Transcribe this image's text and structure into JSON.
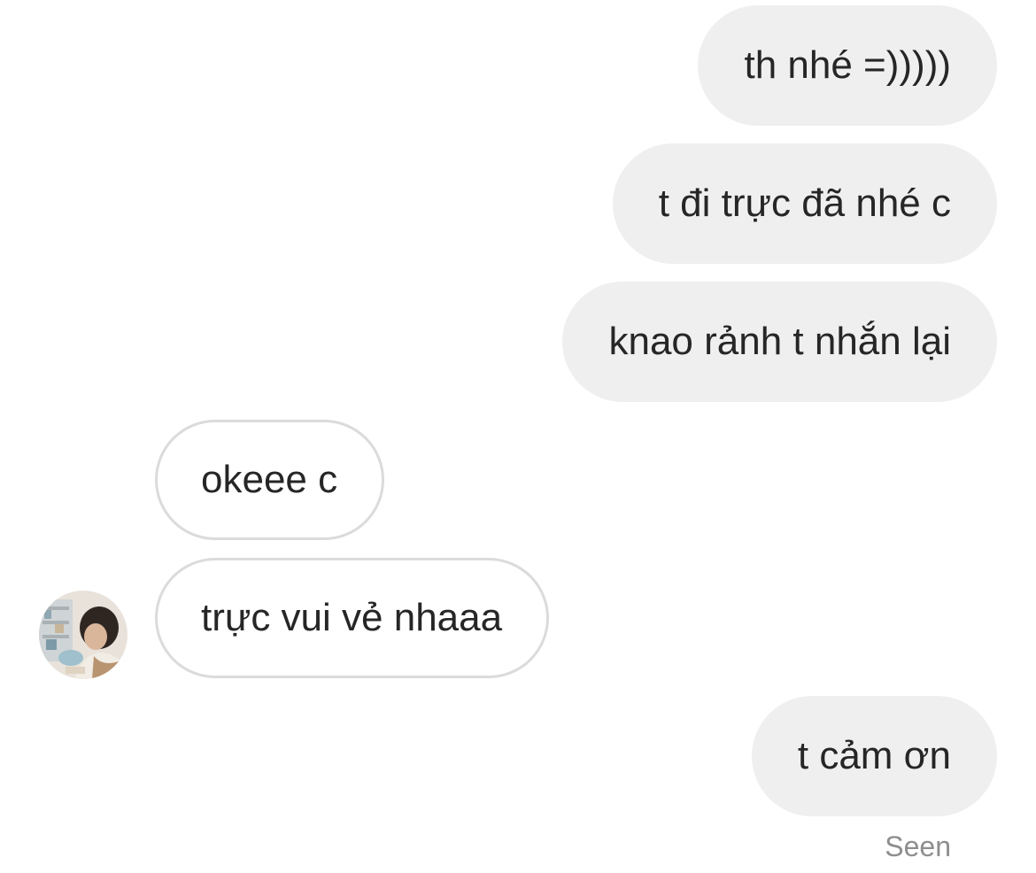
{
  "messages": [
    {
      "side": "outgoing",
      "text": "th nhé =)))))"
    },
    {
      "side": "outgoing",
      "text": "t đi trực đã nhé c"
    },
    {
      "side": "outgoing",
      "text": "knao rảnh t nhắn lại"
    },
    {
      "side": "incoming",
      "text": "okeee c"
    },
    {
      "side": "incoming",
      "text": "trực vui vẻ nhaaa"
    },
    {
      "side": "outgoing",
      "text": "t cảm ơn"
    }
  ],
  "status": {
    "seen_label": "Seen"
  },
  "colors": {
    "outgoing_bubble": "#efefef",
    "incoming_border": "#dbdbdb",
    "text": "#262626",
    "seen_text": "#8e8e8e"
  }
}
